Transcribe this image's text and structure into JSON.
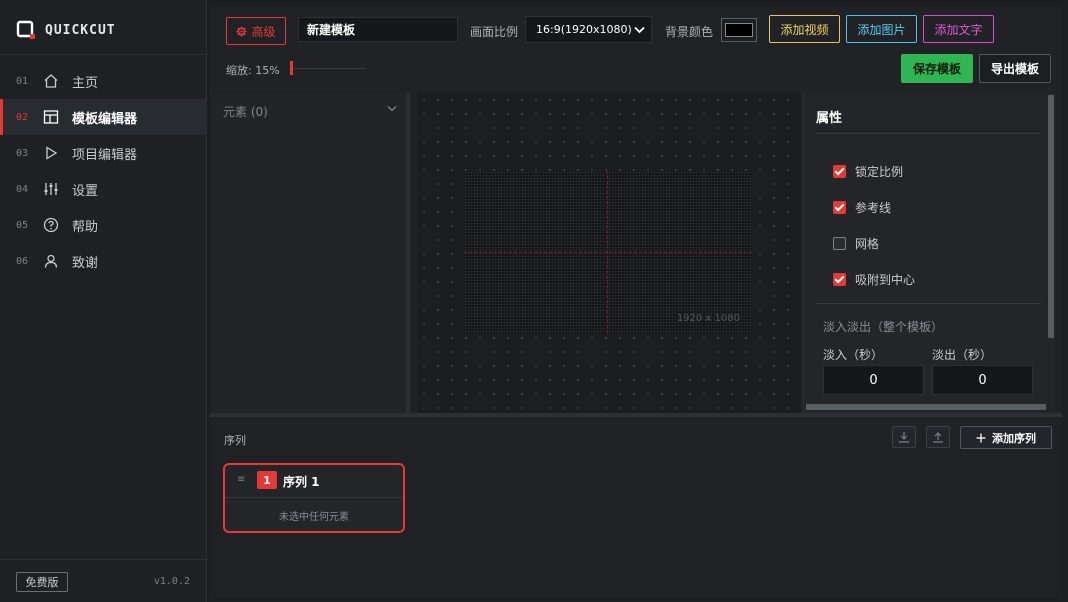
{
  "app": {
    "name": "QUICKCUT",
    "edition": "免费版",
    "version": "v1.0.2"
  },
  "nav": [
    {
      "num": "01",
      "label": "主页",
      "icon": "home-icon"
    },
    {
      "num": "02",
      "label": "模板编辑器",
      "icon": "layout-icon",
      "active": true
    },
    {
      "num": "03",
      "label": "项目编辑器",
      "icon": "play-icon"
    },
    {
      "num": "04",
      "label": "设置",
      "icon": "sliders-icon"
    },
    {
      "num": "05",
      "label": "帮助",
      "icon": "help-icon"
    },
    {
      "num": "06",
      "label": "致谢",
      "icon": "user-icon"
    }
  ],
  "toolbar": {
    "advanced_label": "高级",
    "template_name": "新建模板",
    "ratio_label": "画面比例",
    "ratio_value": "16:9(1920x1080)",
    "bg_color_label": "背景颜色",
    "bg_color": "#000000",
    "add_video": "添加视频",
    "add_image": "添加图片",
    "add_text": "添加文字",
    "zoom_label": "缩放: 15%",
    "zoom_value": 15,
    "save_label": "保存模板",
    "export_label": "导出模板"
  },
  "elements": {
    "title": "元素 (0)"
  },
  "canvas": {
    "resolution": "1920 x 1080"
  },
  "properties": {
    "title": "属性",
    "checkboxes": [
      {
        "label": "锁定比例",
        "checked": true
      },
      {
        "label": "参考线",
        "checked": true
      },
      {
        "label": "网格",
        "checked": false
      },
      {
        "label": "吸附到中心",
        "checked": true
      }
    ],
    "fade_title": "淡入淡出（整个模板）",
    "fade_in_label": "淡入（秒）",
    "fade_out_label": "淡出（秒）",
    "fade_in_value": "0",
    "fade_out_value": "0"
  },
  "sequences": {
    "title": "序列",
    "add_label": "添加序列",
    "items": [
      {
        "index": "1",
        "name": "序列 1",
        "empty_text": "未选中任何元素"
      }
    ]
  },
  "colors": {
    "accent": "#e53935",
    "save": "#2fb551",
    "video": "#f0d75a",
    "image": "#5ccdf0",
    "text": "#e25ad2"
  }
}
